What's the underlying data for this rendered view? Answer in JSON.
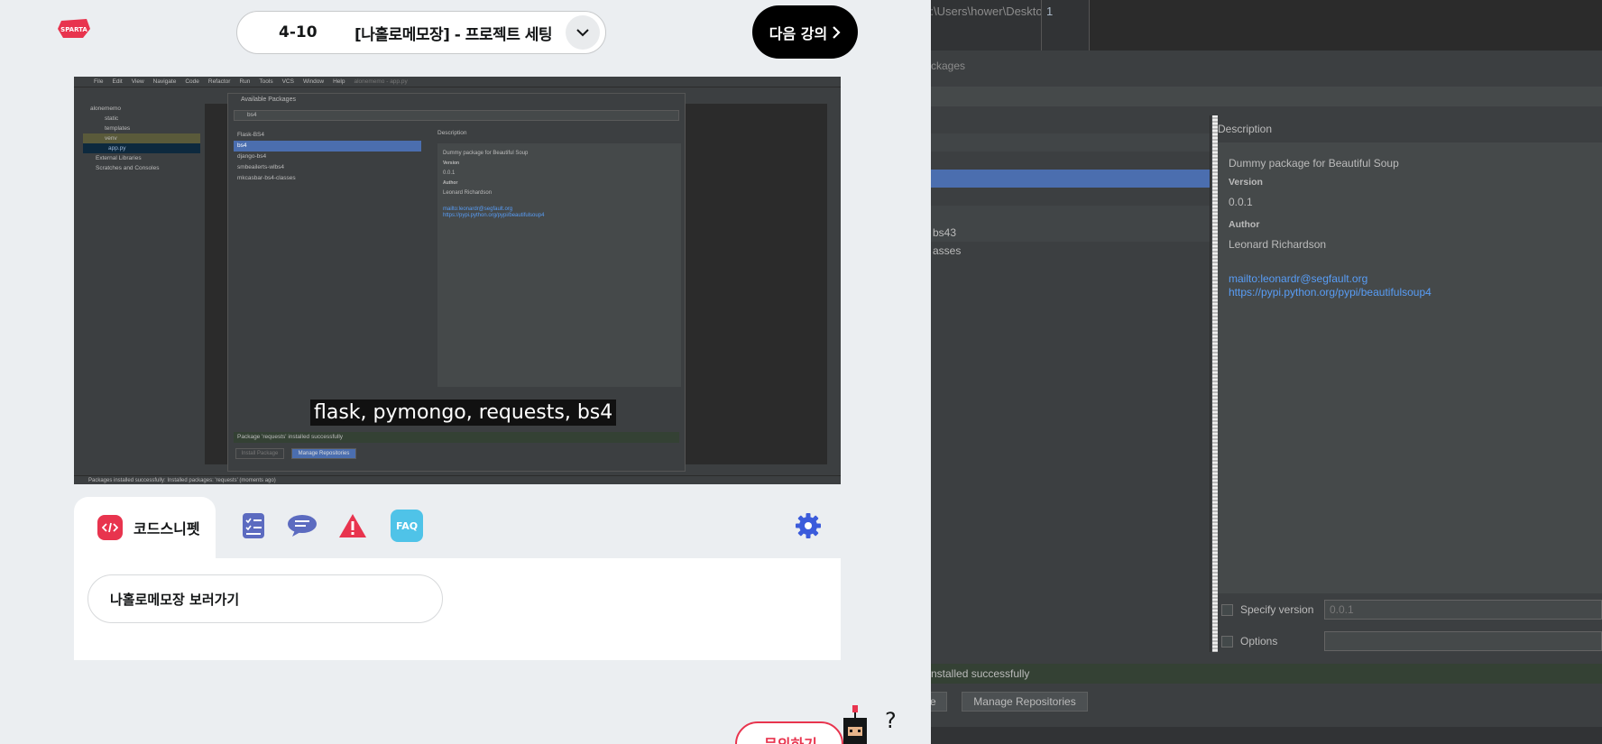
{
  "header": {
    "brand": "SPARTA",
    "lecture_number": "4-10",
    "lecture_title": "[나홀로메모장] - 프로젝트 세팅",
    "next_label": "다음 강의"
  },
  "video": {
    "menu": [
      "File",
      "Edit",
      "View",
      "Navigate",
      "Code",
      "Refactor",
      "Run",
      "Tools",
      "VCS",
      "Window",
      "Help"
    ],
    "project_title": "alonememo - app.py",
    "tree": [
      "alonememo",
      "static",
      "templates",
      "venv",
      "app.py",
      "External Libraries",
      "Scratches and Consoles"
    ],
    "dialog_title": "Available Packages",
    "search_value": "bs4",
    "packages": [
      "Flask-BS4",
      "bs4",
      "django-bs4",
      "smbeailerts-wlbs4",
      "mkcasbar-bs4-classes"
    ],
    "description_heading": "Description",
    "desc_name": "Dummy package for Beautiful Soup",
    "desc_version_label": "Version",
    "desc_version": "0.0.1",
    "desc_author_label": "Author",
    "desc_author": "Leonard Richardson",
    "desc_link1": "mailto:leonardr@segfault.org",
    "desc_link2": "https://pypi.python.org/pypi/beautifulsoup4",
    "success": "Package 'requests' installed successfully",
    "install_btn": "Install Package",
    "manage_btn": "Manage Repositories",
    "status": "Packages installed successfully: Installed packages: 'requests' (moments ago)",
    "subtitle": "flask, pymongo, requests, bs4"
  },
  "tabs": {
    "active_label": "코드스니펫",
    "icons": [
      "code-icon",
      "checklist-icon",
      "chat-icon",
      "warning-icon",
      "faq-icon",
      "gear-icon"
    ],
    "faq_text": "FAQ"
  },
  "content": {
    "snippet_label": "나홀로메모장 보러가기"
  },
  "inquiry_label": "문의하기",
  "ide": {
    "path": "C:\\Users\\hower\\Desktop",
    "line_number": "1",
    "packages_label": "ckages",
    "list_rows": [
      "",
      "",
      "",
      "",
      "",
      "",
      "bs43",
      "asses"
    ],
    "selected_row": 3,
    "description_heading": "Description",
    "desc_name": "Dummy package for Beautiful Soup",
    "version_label": "Version",
    "version": "0.0.1",
    "author_label": "Author",
    "author": "Leonard Richardson",
    "link1": "mailto:leonardr@segfault.org",
    "link2": "https://pypi.python.org/pypi/beautifulsoup4",
    "specify_version_label": "Specify version",
    "specify_version_value": "0.0.1",
    "options_label": "Options",
    "success": "nstalled successfully",
    "install_btn_partial": "e",
    "manage_btn": "Manage Repositories"
  },
  "colors": {
    "brand": "#e8344e",
    "ide_selection": "#4b6eaf",
    "link": "#589df6",
    "tab_icon_blue": "#3b5bdb"
  }
}
